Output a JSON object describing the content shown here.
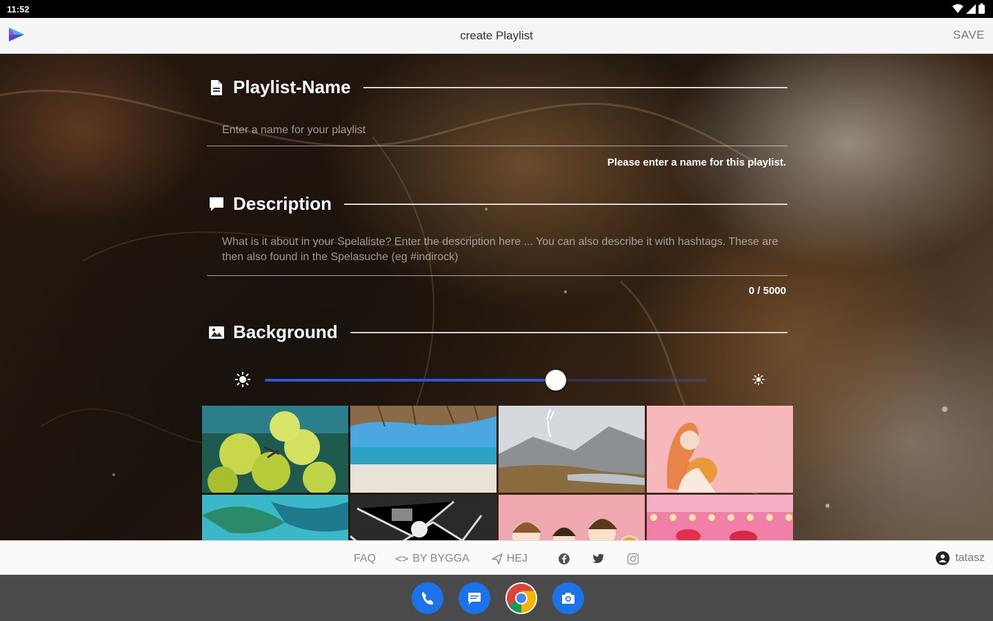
{
  "status_bar": {
    "time": "11:52"
  },
  "app_bar": {
    "title": "create Playlist",
    "save_label": "SAVE"
  },
  "name_section": {
    "heading": "Playlist-Name",
    "placeholder": "Enter a name for your playlist",
    "helper": "Please enter a name for this playlist."
  },
  "description_section": {
    "heading": "Description",
    "placeholder": "What is it about in your Spelaliste? Enter the description here ... You can also describe it with hashtags. These are then also found in the Spelasuche (eg #indirock)",
    "counter": "0 / 5000"
  },
  "background_section": {
    "heading": "Background",
    "brightness": 0.66
  },
  "thumbnails": [
    {
      "name": "thumb-green-fruits"
    },
    {
      "name": "thumb-beach"
    },
    {
      "name": "thumb-foggy-lake"
    },
    {
      "name": "thumb-pink-illustration"
    },
    {
      "name": "thumb-teal-leaves"
    },
    {
      "name": "thumb-bw-sketch"
    },
    {
      "name": "thumb-cartoon-kids"
    },
    {
      "name": "thumb-pink-lights"
    }
  ],
  "footer": {
    "faq": "FAQ",
    "by_bygga": "BY BYGGA",
    "hej": "HEJ",
    "user": "tatasz"
  },
  "colors": {
    "accent": "#2f56d8",
    "phone": "#1a73e8",
    "messages": "#1a73e8",
    "camera": "#1a73e8"
  }
}
